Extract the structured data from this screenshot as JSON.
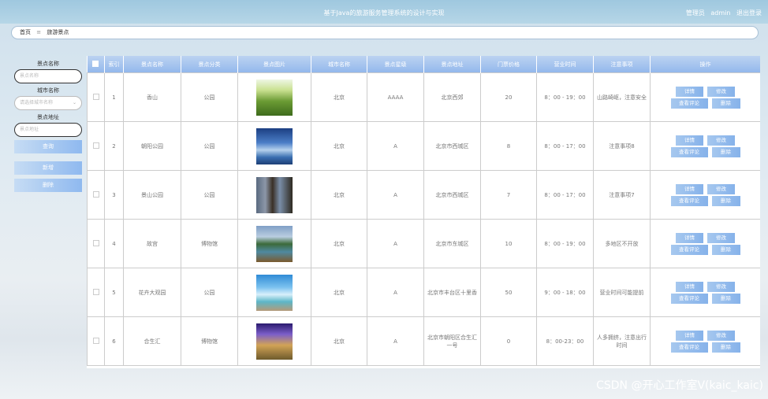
{
  "header": {
    "title": "基于Java的旅游服务管理系统的设计与实现",
    "role": "管理员",
    "username": "admin",
    "logout": "退出登录"
  },
  "breadcrumb": {
    "home": "首页",
    "separator": "≡",
    "current": "旅游景点"
  },
  "sidebar": {
    "name_label": "景点名称",
    "name_placeholder": "景点名称",
    "city_label": "城市名称",
    "city_placeholder": "请选择城市名称",
    "address_label": "景点地址",
    "address_placeholder": "景点地址",
    "search_button": "查询",
    "add_button": "新增",
    "delete_button": "删除"
  },
  "table": {
    "headers": [
      "索引",
      "景点名称",
      "景点分类",
      "景点图片",
      "城市名称",
      "景点星级",
      "景点地址",
      "门票价格",
      "营业时间",
      "注意事项",
      "操作"
    ],
    "rows": [
      {
        "index": "1",
        "name": "香山",
        "category": "公园",
        "image": "green-field-photo",
        "city": "北京",
        "stars": "AAAA",
        "address": "北京西郊",
        "price": "20",
        "hours": "8：00 - 19：00",
        "notes": "山路崎岖，注意安全"
      },
      {
        "index": "2",
        "name": "朝阳公园",
        "category": "公园",
        "image": "sky-lake-photo",
        "city": "北京",
        "stars": "A",
        "address": "北京市西城区",
        "price": "8",
        "hours": "8：00 - 17：00",
        "notes": "注意事项8"
      },
      {
        "index": "3",
        "name": "景山公园",
        "category": "公园",
        "image": "rock-peaks-photo",
        "city": "北京",
        "stars": "A",
        "address": "北京市西城区",
        "price": "7",
        "hours": "8：00 - 17：00",
        "notes": "注意事项7"
      },
      {
        "index": "4",
        "name": "故宫",
        "category": "博物馆",
        "image": "mountain-lake-photo",
        "city": "北京",
        "stars": "A",
        "address": "北京市东城区",
        "price": "10",
        "hours": "8：00 - 19：00",
        "notes": "多地区不开放"
      },
      {
        "index": "5",
        "name": "花卉大观园",
        "category": "公园",
        "image": "seaside-window-photo",
        "city": "北京",
        "stars": "A",
        "address": "北京市丰台区十里香",
        "price": "50",
        "hours": "9：00 - 18：00",
        "notes": "营业时间可能提前"
      },
      {
        "index": "6",
        "name": "合生汇",
        "category": "博物馆",
        "image": "purple-sky-valley-photo",
        "city": "北京",
        "stars": "A",
        "address": "北京市朝阳区合生汇一号",
        "price": "0",
        "hours": "8：00-23：00",
        "notes": "人多拥挤，注意出行时间"
      }
    ],
    "actions": {
      "detail": "详情",
      "edit": "修改",
      "reviews": "查看评论",
      "delete": "删除"
    }
  },
  "watermark": "CSDN @开心工作室V(kaic_kaic)"
}
